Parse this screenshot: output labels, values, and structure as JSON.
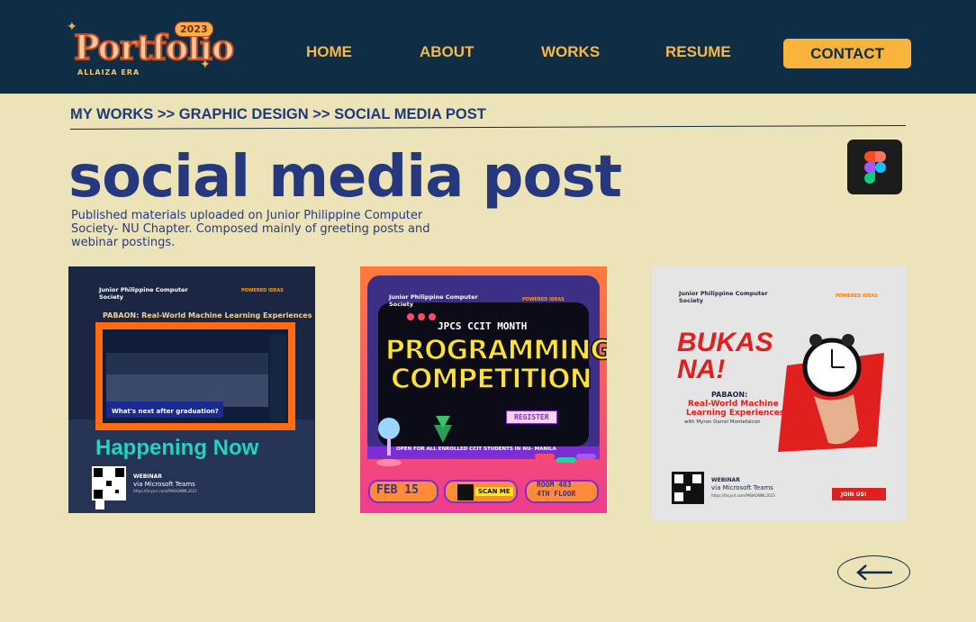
{
  "logo": {
    "word": "Portfolio",
    "year": "2023",
    "subtitle": "ALLAIZA ERA"
  },
  "nav": {
    "home": "HOME",
    "about": "ABOUT",
    "works": "WORKS",
    "resume": "RESUME",
    "contact": "CONTACT"
  },
  "breadcrumb": {
    "part1": "MY WORKS",
    "sep1": " >> ",
    "part2": "GRAPHIC DESIGN",
    "sep2": " >> ",
    "part3": "SOCIAL MEDIA POST"
  },
  "page": {
    "title": "social media post",
    "description": "Published materials uploaded on Junior Philippine Computer Society- NU Chapter. Composed mainly of greeting posts and webinar postings.",
    "tool_icon": "figma-icon"
  },
  "cards": [
    {
      "org": "Junior Philippine Computer Society",
      "partner": "POWERED IDEAS",
      "headline": "PABAON: Real-World Machine Learning Experiences",
      "question": "What's next after graduation?",
      "status": "Happening Now",
      "webinar": "WEBINAR",
      "platform": "via Microsoft Teams",
      "link": "https://tinyurl.com/PABAONML2023"
    },
    {
      "org": "Junior Philippine Computer Society",
      "partner": "POWERED IDEAS",
      "event": "JPCS CCIT MONTH",
      "line1": "PROGRAMMING",
      "line2": "COMPETITION",
      "cta": "REGISTER",
      "eligibility": "OPEN FOR ALL ENROLLED CCIT STUDENTS IN NU- MANILA",
      "date": "FEB 15",
      "scan": "SCAN ME",
      "room1": "ROOM 403",
      "room2": "4TH FLOOR"
    },
    {
      "org": "Junior Philippine Computer Society",
      "partner": "POWERED IDEAS",
      "headline1": "BUKAS",
      "headline2": "NA!",
      "pabaon": "PABAON:",
      "topic1": "Real-World Machine",
      "topic2": "Learning Experiences",
      "speaker": "with Myron Darrel Montefalcon",
      "webinar": "WEBINAR",
      "platform": "via Microsoft Teams",
      "link": "https://tinyurl.com/PABAONML2023",
      "cta": "JOIN US!"
    }
  ],
  "colors": {
    "header_bg": "#0f2d44",
    "page_bg": "#ede3b8",
    "accent": "#f8b33c",
    "title": "#27397e"
  }
}
